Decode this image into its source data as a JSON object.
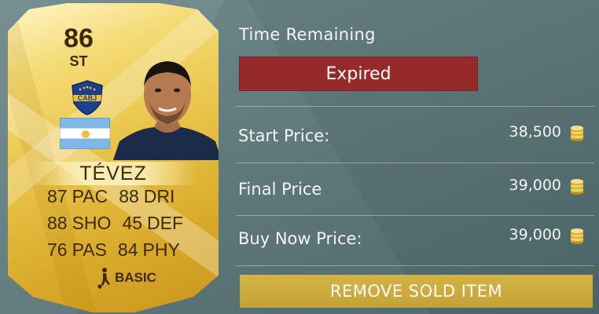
{
  "card": {
    "rating": "86",
    "position": "ST",
    "club_badge_text": "CABJ",
    "name": "TÉVEZ",
    "stats": [
      [
        {
          "value": "87",
          "label": "PAC"
        },
        {
          "value": "88",
          "label": "DRI"
        }
      ],
      [
        {
          "value": "88",
          "label": "SHO"
        },
        {
          "value": "45",
          "label": "DEF"
        }
      ],
      [
        {
          "value": "76",
          "label": "PAS"
        },
        {
          "value": "84",
          "label": "PHY"
        }
      ]
    ],
    "chemistry_style": "BASIC",
    "colors": {
      "gold": "#e9c54a",
      "text": "#3b2a05",
      "club_blue": "#1c3f8f",
      "club_gold": "#f2c230"
    }
  },
  "panel": {
    "time_remaining_label": "Time Remaining",
    "status": "Expired",
    "status_color": "#962a2b",
    "prices": [
      {
        "label": "Start Price:",
        "value": "38,500",
        "icon": "coins-icon"
      },
      {
        "label": "Final Price",
        "value": "39,000",
        "icon": "coins-icon"
      },
      {
        "label": "Buy Now Price:",
        "value": "39,000",
        "icon": "coins-icon"
      }
    ],
    "remove_button_label": "REMOVE SOLD ITEM",
    "button_color": "#c9a93c"
  }
}
